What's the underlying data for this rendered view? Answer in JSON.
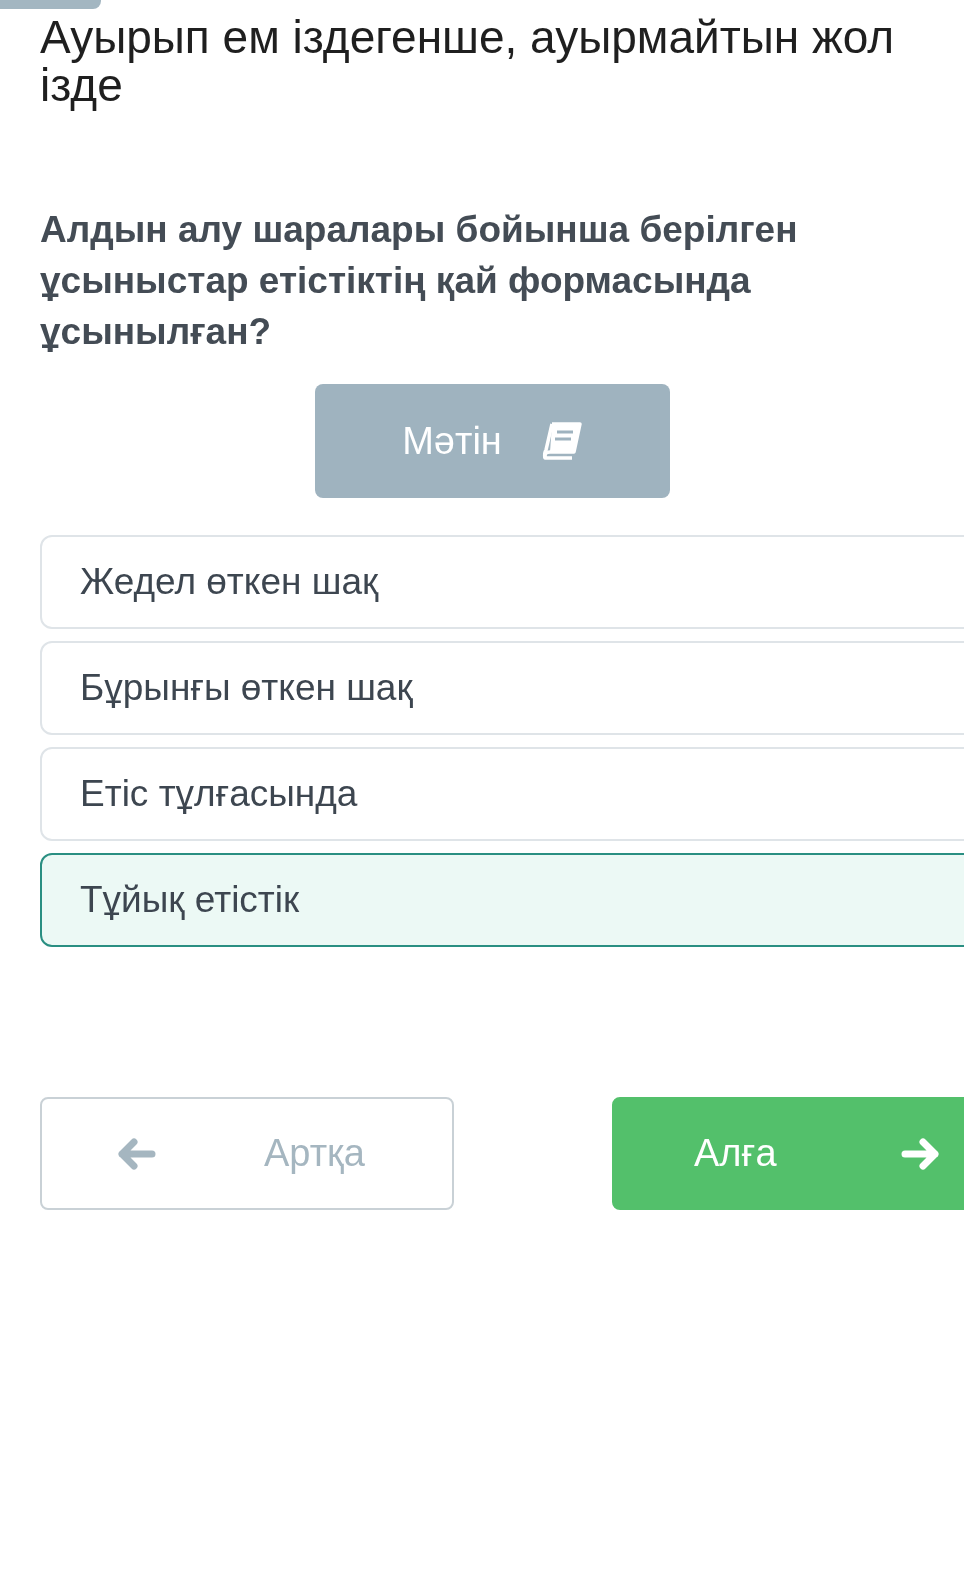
{
  "title": "Ауырып ем іздегенше, ауырмайтын жол ізде",
  "question": "Алдын алу шаралары бойынша берілген ұсыныстар етістіктің қай формасында ұсынылған?",
  "text_button": {
    "label": "Мәтін"
  },
  "options": [
    {
      "label": "Жедел өткен шақ",
      "selected": false
    },
    {
      "label": "Бұрынғы өткен шақ",
      "selected": false
    },
    {
      "label": "Етіс тұлғасында",
      "selected": false
    },
    {
      "label": "Тұйық етістік",
      "selected": true
    }
  ],
  "nav": [
    {
      "kind": "back",
      "label": "Артқа",
      "disabled": true
    },
    {
      "kind": "next",
      "label": "Алға",
      "disabled": false
    }
  ]
}
